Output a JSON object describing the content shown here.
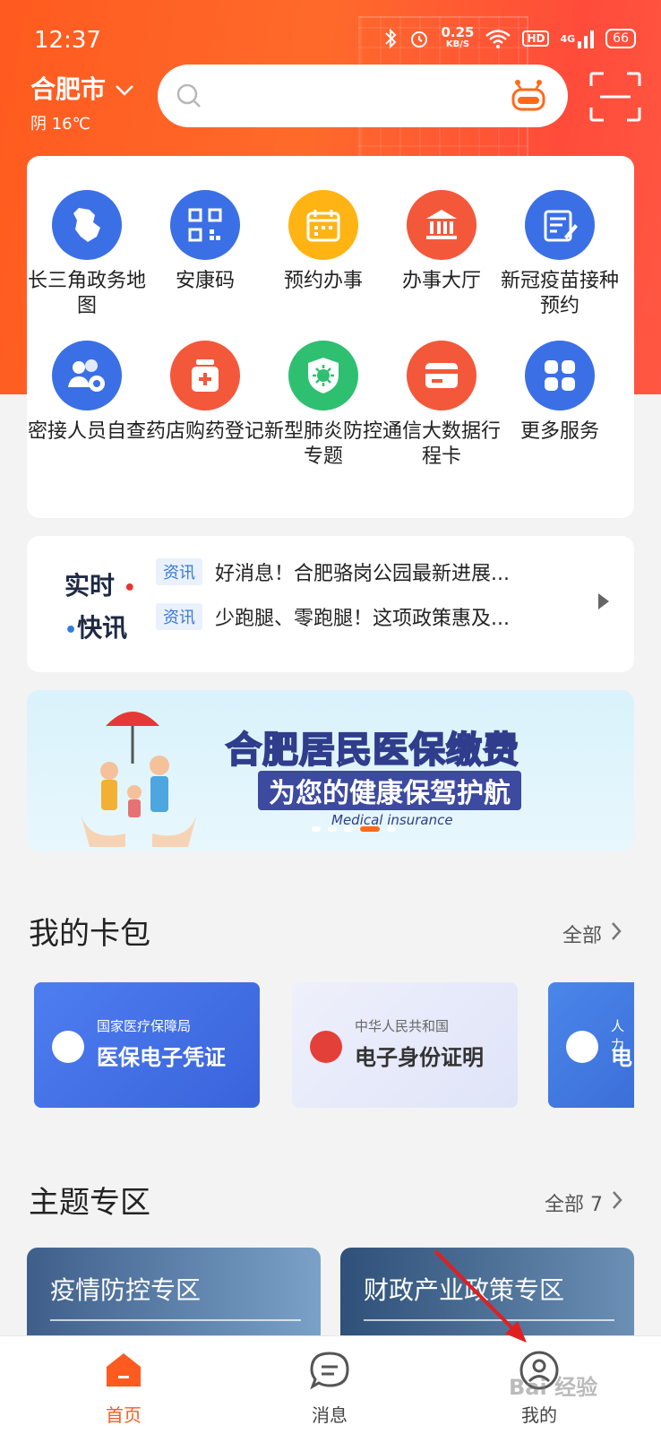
{
  "status_bar": {
    "time": "12:37",
    "net_speed_value": "0.25",
    "net_speed_unit": "KB/S",
    "hd": "HD",
    "signal": "4G",
    "battery": "66"
  },
  "header": {
    "city": "合肥市",
    "weather": "阴 16℃",
    "search_placeholder": ""
  },
  "services": [
    {
      "label": "长三角政务地图",
      "icon": "map-icon",
      "color": "#3b6fe6"
    },
    {
      "label": "安康码",
      "icon": "qrcode-icon",
      "color": "#3b6fe6"
    },
    {
      "label": "预约办事",
      "icon": "calendar-icon",
      "color": "#ffb414"
    },
    {
      "label": "办事大厅",
      "icon": "hall-icon",
      "color": "#f3583b"
    },
    {
      "label": "新冠疫苗接种预约",
      "icon": "form-edit-icon",
      "color": "#3b6fe6"
    },
    {
      "label": "密接人员自查",
      "icon": "people-virus-icon",
      "color": "#3b6fe6"
    },
    {
      "label": "药店购药登记",
      "icon": "medicine-icon",
      "color": "#f3583b"
    },
    {
      "label": "新型肺炎防控专题",
      "icon": "virus-shield-icon",
      "color": "#2fbf71"
    },
    {
      "label": "通信大数据行程卡",
      "icon": "card-icon",
      "color": "#f3583b"
    },
    {
      "label": "更多服务",
      "icon": "grid-icon",
      "color": "#3b6fe6"
    }
  ],
  "news": {
    "logo_line1": "实时",
    "logo_line2": "快讯",
    "items": [
      {
        "tag": "资讯",
        "text": "好消息！合肥骆岗公园最新进展..."
      },
      {
        "tag": "资讯",
        "text": "少跑腿、零跑腿！这项政策惠及..."
      }
    ]
  },
  "banner": {
    "title": "合肥居民医保缴费",
    "subtitle": "为您的健康保驾护航",
    "english": "Medical insurance"
  },
  "wallet": {
    "title": "我的卡包",
    "more": "全部",
    "cards": [
      {
        "issuer": "国家医疗保障局",
        "name": "医保电子凭证"
      },
      {
        "issuer": "中华人民共和国",
        "name": "电子身份证明"
      },
      {
        "issuer": "人力",
        "name": "电"
      }
    ]
  },
  "topics": {
    "title": "主题专区",
    "more": "全部 7",
    "items": [
      {
        "label": "疫情防控专区"
      },
      {
        "label": "财政产业政策专区"
      }
    ]
  },
  "tabbar": {
    "items": [
      {
        "label": "首页",
        "active": true
      },
      {
        "label": "消息",
        "active": false
      },
      {
        "label": "我的",
        "active": false
      }
    ]
  },
  "colors": {
    "brand": "#ff5a1f",
    "active_tab": "#ff5a1f"
  },
  "watermark": "Bai 经验"
}
